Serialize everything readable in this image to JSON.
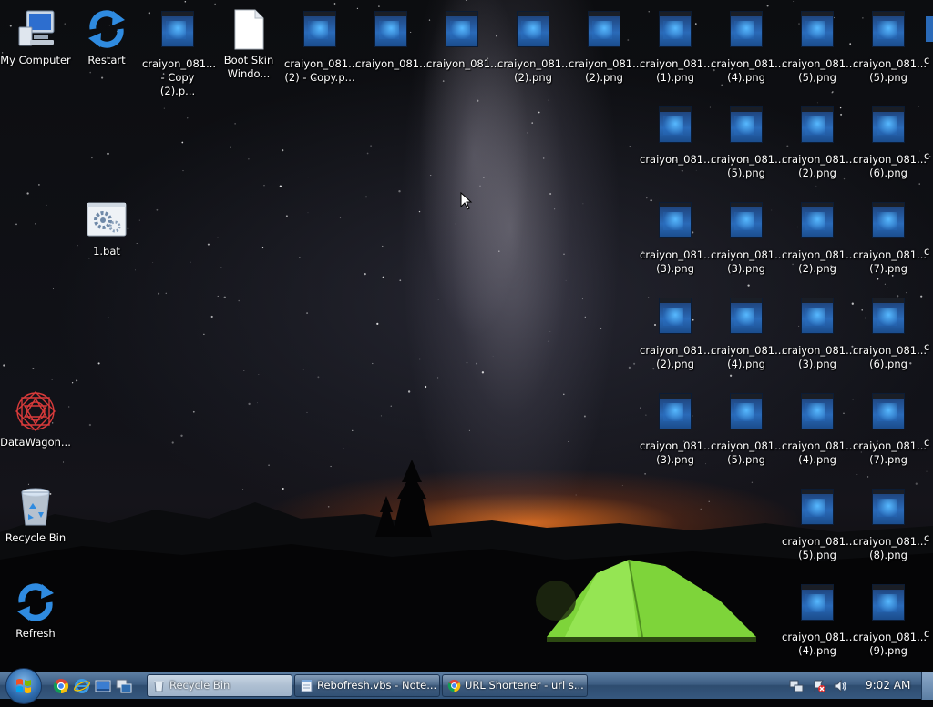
{
  "desktop": {
    "left_icons": [
      {
        "label": "My Computer",
        "icon": "computer-icon"
      },
      {
        "label": "Restart",
        "icon": "refresh-arrows-icon"
      },
      {
        "label": "1.bat",
        "icon": "batch-file-gear-icon"
      },
      {
        "label": "DataWagon...",
        "icon": "red-mandala-icon"
      },
      {
        "label": "Recycle Bin",
        "icon": "recycle-bin-icon"
      },
      {
        "label": "Refresh",
        "icon": "refresh-arrows-icon"
      }
    ],
    "top_row": [
      {
        "label": "craiyon_081...\n- Copy (2).p..."
      },
      {
        "label": "Boot Skin\nWindo...",
        "icon": "blank-document-icon"
      },
      {
        "label": "craiyon_081...\n(2) - Copy.p..."
      },
      {
        "label": "craiyon_081..."
      },
      {
        "label": "craiyon_081..."
      },
      {
        "label": "craiyon_081...\n(2).png"
      },
      {
        "label": "craiyon_081...\n(2).png"
      },
      {
        "label": "craiyon_081...\n(1).png"
      },
      {
        "label": "craiyon_081...\n(4).png"
      },
      {
        "label": "craiyon_081...\n(5).png"
      },
      {
        "label": "craiyon_081...\n(5).png"
      }
    ],
    "grid_rows": [
      [
        "craiyon_081...\n(5).png",
        "craiyon_081...\n(2).png",
        "craiyon_081...\n(6).png"
      ],
      [
        "craiyon_081...\n(3).png",
        "craiyon_081...\n(2).png",
        "craiyon_081...\n(7).png"
      ],
      [
        "craiyon_081...\n(4).png",
        "craiyon_081...\n(3).png",
        "craiyon_081...\n(6).png"
      ],
      [
        "craiyon_081...\n(5).png",
        "craiyon_081...\n(4).png",
        "craiyon_081...\n(7).png"
      ]
    ],
    "grid_rows_first_col": [
      "craiyon_081...",
      "craiyon_081...\n(3).png",
      "craiyon_081...\n(2).png",
      "craiyon_081...\n(3).png"
    ],
    "lower_rows": [
      [
        "craiyon_081...\n(5).png",
        "craiyon_081...\n(8).png"
      ],
      [
        "craiyon_081...\n(4).png",
        "craiyon_081...\n(9).png"
      ]
    ],
    "edge_labels": [
      "c",
      "c",
      "c",
      "c",
      "c",
      "c",
      "c"
    ]
  },
  "taskbar": {
    "tasks": [
      {
        "label": "Recycle Bin",
        "icon": "recycle-bin-icon",
        "active": true
      },
      {
        "label": "Rebofresh.vbs - Note...",
        "icon": "notepad-icon",
        "active": false
      },
      {
        "label": "URL Shortener - url s...",
        "icon": "chrome-icon",
        "active": false
      }
    ],
    "quick_launch": [
      "chrome-icon",
      "internet-explorer-icon",
      "show-desktop-icon",
      "window-switcher-icon"
    ],
    "tray_icons": [
      "network-icon",
      "action-center-flag-icon",
      "volume-icon"
    ],
    "clock": "9:02 AM"
  },
  "colors": {
    "taskbar": "#3d5d82",
    "tent": "#7ed43a",
    "horizon_glow": "#e06e1e"
  }
}
